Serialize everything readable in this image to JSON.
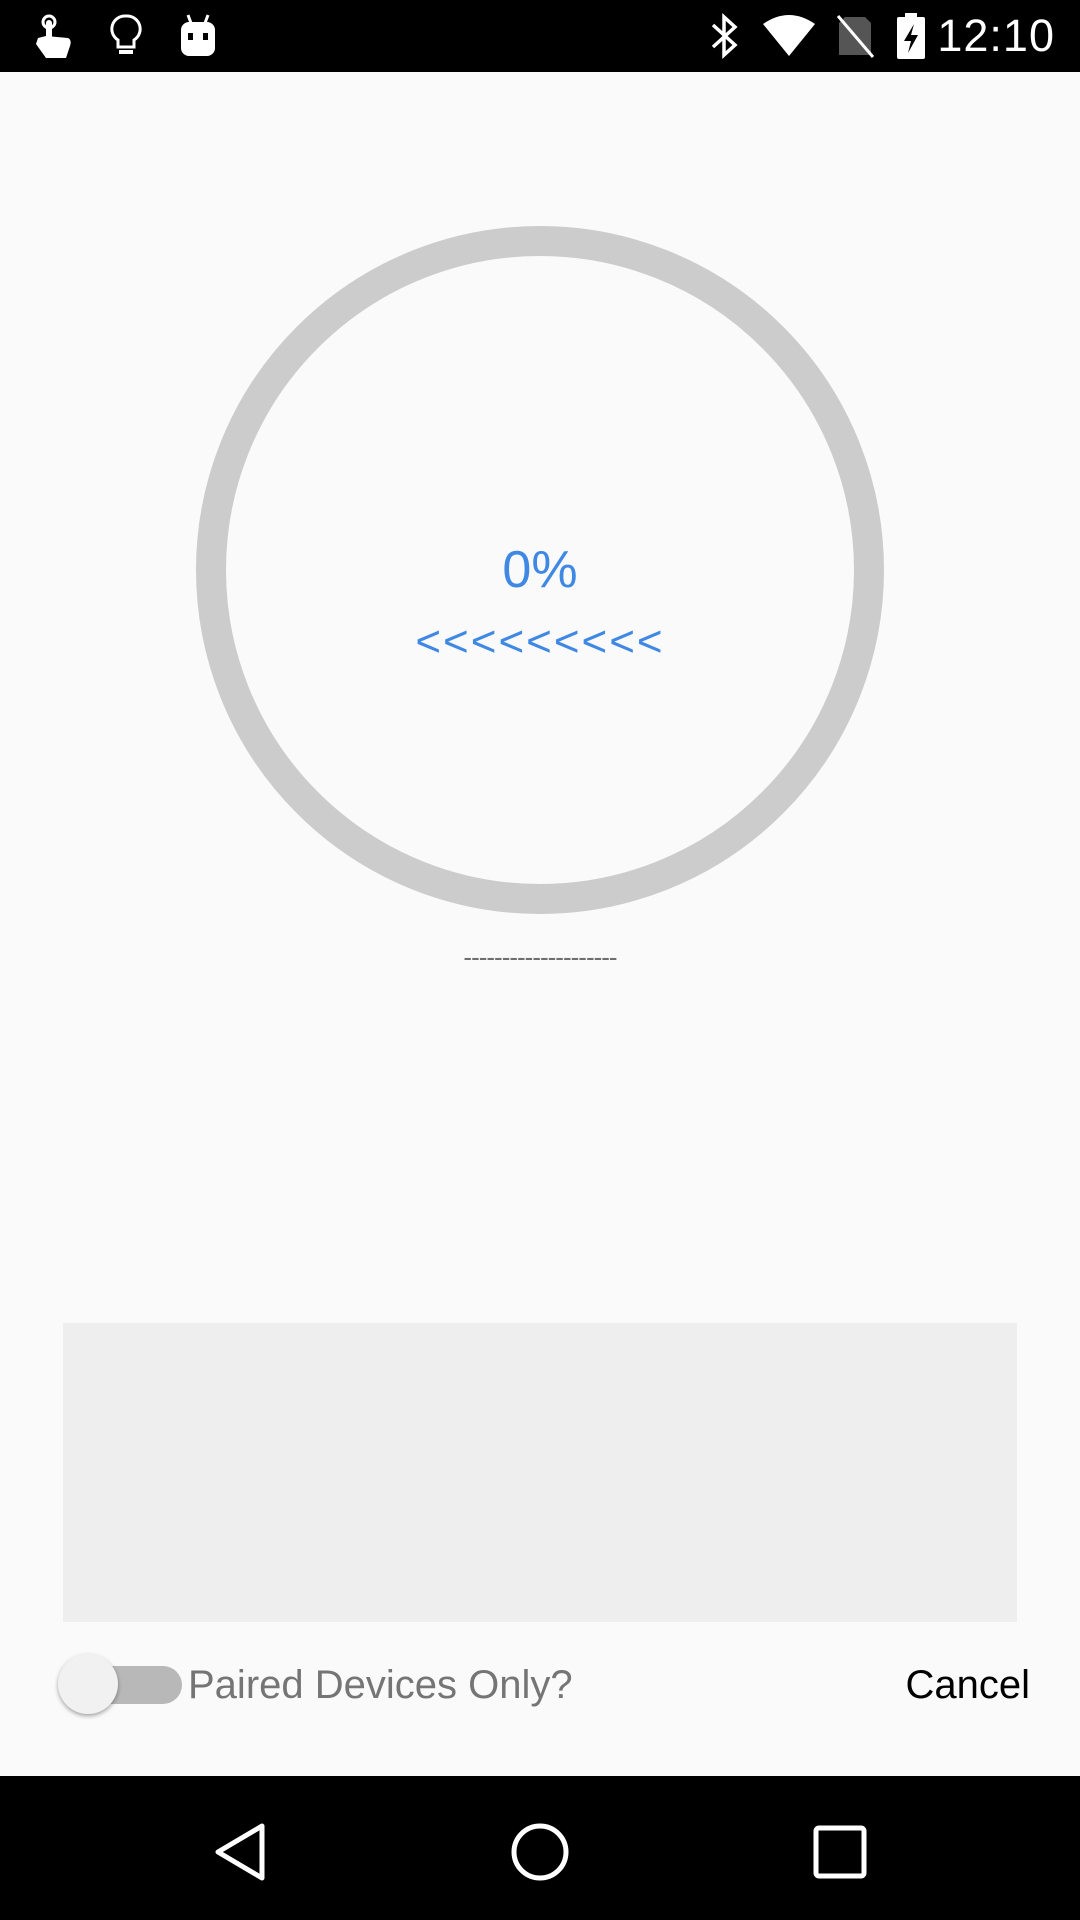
{
  "status_bar": {
    "time": "12:10",
    "left_icons": [
      "touch-gesture-icon",
      "lightbulb-icon",
      "android-icon"
    ],
    "right_icons": [
      "bluetooth-icon",
      "wifi-icon",
      "no-sim-icon",
      "battery-charging-icon"
    ]
  },
  "progress": {
    "percent_text": "0%",
    "value": 0,
    "direction_text": "<<<<<<<<<",
    "status_text": "--------------------",
    "ring_color": "#cccccc",
    "accent_color": "#3f88e3"
  },
  "controls": {
    "paired_only_label": "Paired Devices Only?",
    "paired_only_on": false,
    "cancel_label": "Cancel"
  },
  "nav_bar": {
    "buttons": [
      "back-icon",
      "home-icon",
      "recents-icon"
    ]
  }
}
